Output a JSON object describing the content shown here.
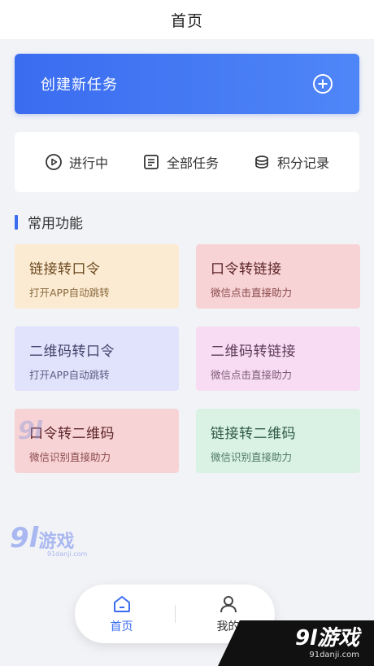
{
  "header": {
    "title": "首页"
  },
  "create_task": {
    "label": "创建新任务",
    "icon": "plus-circle-icon"
  },
  "tabs": [
    {
      "label": "进行中",
      "icon": "play-circle-icon"
    },
    {
      "label": "全部任务",
      "icon": "list-icon"
    },
    {
      "label": "积分记录",
      "icon": "coins-icon"
    }
  ],
  "section": {
    "title": "常用功能",
    "accent": "#3a6cf0"
  },
  "functions": [
    {
      "name": "链接转口令",
      "desc": "打开APP自动跳转",
      "color": "#fcebd3"
    },
    {
      "name": "口令转链接",
      "desc": "微信点击直接助力",
      "color": "#f8d3d5"
    },
    {
      "name": "二维码转口令",
      "desc": "打开APP自动跳转",
      "color": "#e1e2fb"
    },
    {
      "name": "二维码转链接",
      "desc": "微信点击直接助力",
      "color": "#f8dcf3"
    },
    {
      "name": "口令转二维码",
      "desc": "微信识别直接助力",
      "color": "#f8d3d5"
    },
    {
      "name": "链接转二维码",
      "desc": "微信识别直接助力",
      "color": "#d9f2e3"
    }
  ],
  "watermark": {
    "logo_num": "9l",
    "logo_text": "游戏",
    "site": "91danji.com"
  },
  "bottom_nav": [
    {
      "label": "首页",
      "icon": "home-icon",
      "active": true
    },
    {
      "label": "我的",
      "icon": "user-icon",
      "active": false
    }
  ]
}
